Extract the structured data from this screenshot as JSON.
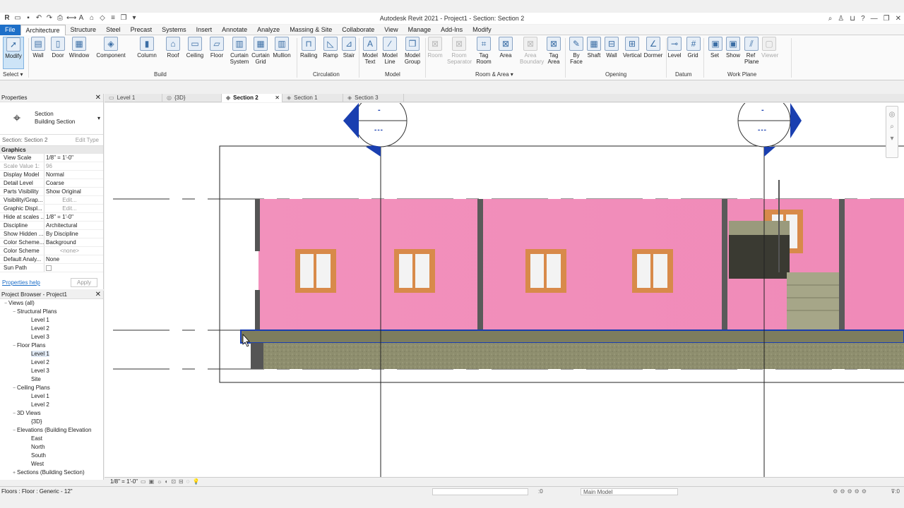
{
  "window": {
    "title": "Autodesk Revit 2021 - Project1 - Section: Section 2"
  },
  "menu": [
    {
      "label": "File",
      "kind": "file"
    },
    {
      "label": "Architecture",
      "kind": "active"
    },
    {
      "label": "Structure"
    },
    {
      "label": "Steel"
    },
    {
      "label": "Precast"
    },
    {
      "label": "Systems"
    },
    {
      "label": "Insert"
    },
    {
      "label": "Annotate"
    },
    {
      "label": "Analyze"
    },
    {
      "label": "Massing & Site"
    },
    {
      "label": "Collaborate"
    },
    {
      "label": "View"
    },
    {
      "label": "Manage"
    },
    {
      "label": "Add-Ins"
    },
    {
      "label": "Modify"
    }
  ],
  "ribbon": {
    "buttons": [
      {
        "label": "Modify",
        "icon": "cursor-icon",
        "glyph": "➚",
        "sel": true
      },
      {
        "label": "Wall",
        "icon": "wall-icon",
        "glyph": "▤"
      },
      {
        "label": "Door",
        "icon": "door-icon",
        "glyph": "▯"
      },
      {
        "label": "Window",
        "icon": "window-icon",
        "glyph": "▦"
      },
      {
        "label": "Component",
        "icon": "component-icon",
        "glyph": "◈"
      },
      {
        "label": "Column",
        "icon": "column-icon",
        "glyph": "▮"
      },
      {
        "label": "Roof",
        "icon": "roof-icon",
        "glyph": "⌂"
      },
      {
        "label": "Ceiling",
        "icon": "ceiling-icon",
        "glyph": "▭"
      },
      {
        "label": "Floor",
        "icon": "floor-icon",
        "glyph": "▱"
      },
      {
        "label": "Curtain\nSystem",
        "icon": "curtain-system-icon",
        "glyph": "▥"
      },
      {
        "label": "Curtain\nGrid",
        "icon": "curtain-grid-icon",
        "glyph": "▦"
      },
      {
        "label": "Mullion",
        "icon": "mullion-icon",
        "glyph": "▥"
      },
      {
        "label": "Railing",
        "icon": "railing-icon",
        "glyph": "⊓"
      },
      {
        "label": "Ramp",
        "icon": "ramp-icon",
        "glyph": "◺"
      },
      {
        "label": "Stair",
        "icon": "stair-icon",
        "glyph": "⊿"
      },
      {
        "label": "Model\nText",
        "icon": "model-text-icon",
        "glyph": "A"
      },
      {
        "label": "Model\nLine",
        "icon": "model-line-icon",
        "glyph": "∕"
      },
      {
        "label": "Model\nGroup",
        "icon": "model-group-icon",
        "glyph": "❒"
      },
      {
        "label": "Room",
        "icon": "room-icon",
        "glyph": "⊠",
        "dis": true
      },
      {
        "label": "Room\nSeparator",
        "icon": "room-separator-icon",
        "glyph": "⊠",
        "dis": true
      },
      {
        "label": "Tag\nRoom",
        "icon": "tag-room-icon",
        "glyph": "⌗"
      },
      {
        "label": "Area",
        "icon": "area-icon",
        "glyph": "⊠"
      },
      {
        "label": "Area\nBoundary",
        "icon": "area-boundary-icon",
        "glyph": "⊠",
        "dis": true
      },
      {
        "label": "Tag\nArea",
        "icon": "tag-area-icon",
        "glyph": "⊠"
      },
      {
        "label": "By\nFace",
        "icon": "by-face-icon",
        "glyph": "✎"
      },
      {
        "label": "Shaft",
        "icon": "shaft-icon",
        "glyph": "▦"
      },
      {
        "label": "Wall",
        "icon": "wall-opening-icon",
        "glyph": "⊟"
      },
      {
        "label": "Vertical",
        "icon": "vertical-opening-icon",
        "glyph": "⊞"
      },
      {
        "label": "Dormer",
        "icon": "dormer-icon",
        "glyph": "∠"
      },
      {
        "label": "Level",
        "icon": "level-icon",
        "glyph": "⊸"
      },
      {
        "label": "Grid",
        "icon": "grid-icon",
        "glyph": "#"
      },
      {
        "label": "Set",
        "icon": "set-icon",
        "glyph": "▣"
      },
      {
        "label": "Show",
        "icon": "show-icon",
        "glyph": "▣"
      },
      {
        "label": "Ref\nPlane",
        "icon": "ref-plane-icon",
        "glyph": "⫽"
      },
      {
        "label": "Viewer",
        "icon": "viewer-icon",
        "glyph": "▢",
        "dis": true
      }
    ],
    "panels": [
      {
        "label": "Select ▾"
      },
      {
        "label": "Build"
      },
      {
        "label": "Circulation"
      },
      {
        "label": "Model"
      },
      {
        "label": "Room & Area ▾"
      },
      {
        "label": "Opening"
      },
      {
        "label": "Datum"
      },
      {
        "label": "Work Plane"
      }
    ]
  },
  "properties": {
    "title": "Properties",
    "type_line1": "Section",
    "type_line2": "Building Section",
    "instance": "Section: Section 2",
    "edit_type": "Edit Type",
    "group": "Graphics",
    "rows": [
      {
        "k": "View Scale",
        "v": "1/8\" = 1'-0\""
      },
      {
        "k": "Scale Value    1:",
        "v": "96",
        "gray": true
      },
      {
        "k": "Display Model",
        "v": "Normal"
      },
      {
        "k": "Detail Level",
        "v": "Coarse"
      },
      {
        "k": "Parts Visibility",
        "v": "Show Original"
      },
      {
        "k": "Visibility/Grap...",
        "v": "Edit...",
        "btn": true
      },
      {
        "k": "Graphic Displ...",
        "v": "Edit...",
        "btn": true
      },
      {
        "k": "Hide at scales ...",
        "v": "1/8\" = 1'-0\""
      },
      {
        "k": "Discipline",
        "v": "Architectural"
      },
      {
        "k": "Show Hidden ...",
        "v": "By Discipline"
      },
      {
        "k": "Color Scheme...",
        "v": "Background"
      },
      {
        "k": "Color Scheme",
        "v": "<none>",
        "btn": true
      },
      {
        "k": "Default Analy...",
        "v": "None"
      },
      {
        "k": "Sun Path",
        "v": ""
      }
    ],
    "help": "Properties help",
    "apply": "Apply"
  },
  "browser": {
    "title": "Project Browser - Project1",
    "nodes": [
      {
        "label": "Views (all)",
        "depth": 0,
        "toggle": "−"
      },
      {
        "label": "Structural Plans",
        "depth": 1,
        "toggle": "−"
      },
      {
        "label": "Level 1",
        "depth": 2
      },
      {
        "label": "Level 2",
        "depth": 2
      },
      {
        "label": "Level 3",
        "depth": 2
      },
      {
        "label": "Floor Plans",
        "depth": 1,
        "toggle": "−"
      },
      {
        "label": "Level 1",
        "depth": 2,
        "sel": true
      },
      {
        "label": "Level 2",
        "depth": 2
      },
      {
        "label": "Level 3",
        "depth": 2
      },
      {
        "label": "Site",
        "depth": 2
      },
      {
        "label": "Ceiling Plans",
        "depth": 1,
        "toggle": "−"
      },
      {
        "label": "Level 1",
        "depth": 2
      },
      {
        "label": "Level 2",
        "depth": 2
      },
      {
        "label": "3D Views",
        "depth": 1,
        "toggle": "−"
      },
      {
        "label": "{3D}",
        "depth": 2
      },
      {
        "label": "Elevations (Building Elevation",
        "depth": 1,
        "toggle": "−"
      },
      {
        "label": "East",
        "depth": 2
      },
      {
        "label": "North",
        "depth": 2
      },
      {
        "label": "South",
        "depth": 2
      },
      {
        "label": "West",
        "depth": 2
      },
      {
        "label": "Sections (Building Section)",
        "depth": 1,
        "toggle": "+"
      }
    ]
  },
  "viewtabs": [
    {
      "label": "Level 1",
      "icon": "▭",
      "w": 82
    },
    {
      "label": "{3D}",
      "icon": "◎",
      "w": 84
    },
    {
      "label": "Section 2",
      "icon": "◈",
      "w": 86,
      "active": true
    },
    {
      "label": "Section 1",
      "icon": "◈",
      "w": 86
    },
    {
      "label": "Section 3",
      "icon": "◈",
      "w": 86
    }
  ],
  "section_heads": [
    {
      "num": "-",
      "sheet": "---"
    },
    {
      "num": "-",
      "sheet": "---"
    }
  ],
  "viewbar": {
    "scale": "1/8\" = 1'-0\""
  },
  "status": {
    "message": "Floors : Floor : Generic - 12\"",
    "count": ":0",
    "model": "Main Model",
    "filter": ":0"
  },
  "colors": {
    "wall": "#f291bc",
    "floor": "#8a8a6a",
    "section_blue": "#1a3fb0",
    "file_tab": "#1d6fc8"
  }
}
